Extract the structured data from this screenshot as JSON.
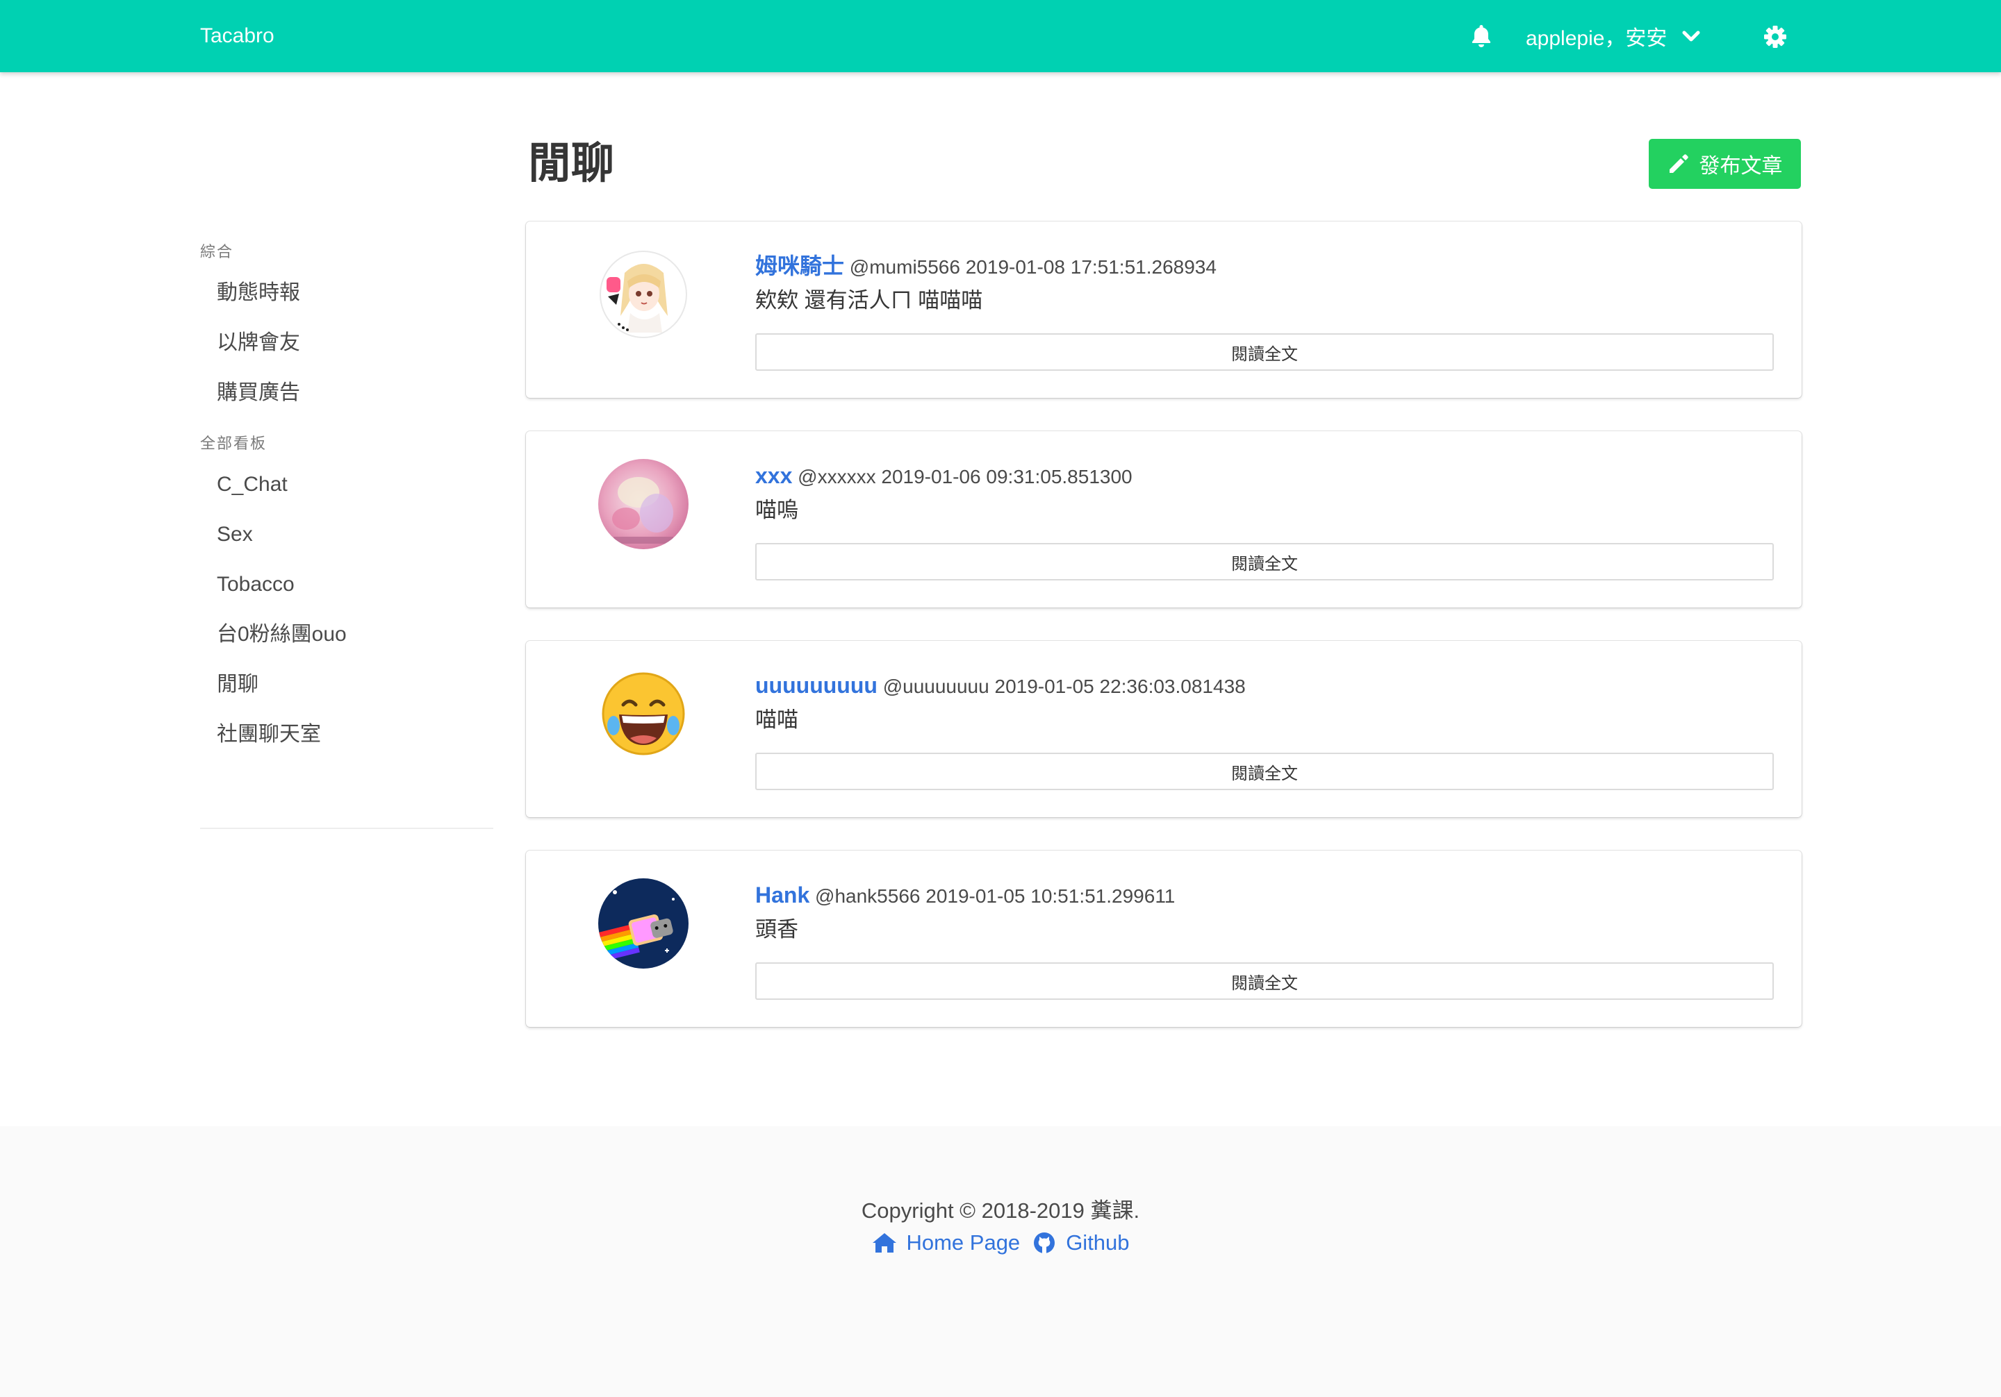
{
  "navbar": {
    "brand": "Tacabro",
    "user_label": "applepie，安安",
    "bell_icon": "bell-icon",
    "dropdown_icon": "chevron-down-icon",
    "settings_icon": "gear-icon",
    "background": "#00d1b2"
  },
  "sidebar": {
    "section1_label": "綜合",
    "section1_items": [
      "動態時報",
      "以牌會友",
      "購買廣告"
    ],
    "section2_label": "全部看板",
    "section2_items": [
      "C_Chat",
      "Sex",
      "Tobacco",
      "台0粉絲團ouo",
      "閒聊",
      "社團聊天室"
    ]
  },
  "main": {
    "title": "閒聊",
    "publish_label": "發布文章",
    "publish_icon": "pencil-icon",
    "publish_color": "#23d160",
    "read_more_label": "閱讀全文",
    "posts": [
      {
        "name": "姆咪騎士",
        "handle": "@mumi5566",
        "time": "2019-01-08 17:51:51.268934",
        "body": "欸欸 還有活人ㄇ 喵喵喵"
      },
      {
        "name": "xxx",
        "handle": "@xxxxxx",
        "time": "2019-01-06 09:31:05.851300",
        "body": "喵嗚"
      },
      {
        "name": "uuuuuuuuu",
        "handle": "@uuuuuuuu",
        "time": "2019-01-05 22:36:03.081438",
        "body": "喵喵"
      },
      {
        "name": "Hank",
        "handle": "@hank5566",
        "time": "2019-01-05 10:51:51.299611",
        "body": "頭香"
      }
    ]
  },
  "footer": {
    "copyright": "Copyright © 2018-2019 糞課.",
    "home_label": "Home Page",
    "github_label": "Github",
    "link_color": "#3273dc"
  }
}
